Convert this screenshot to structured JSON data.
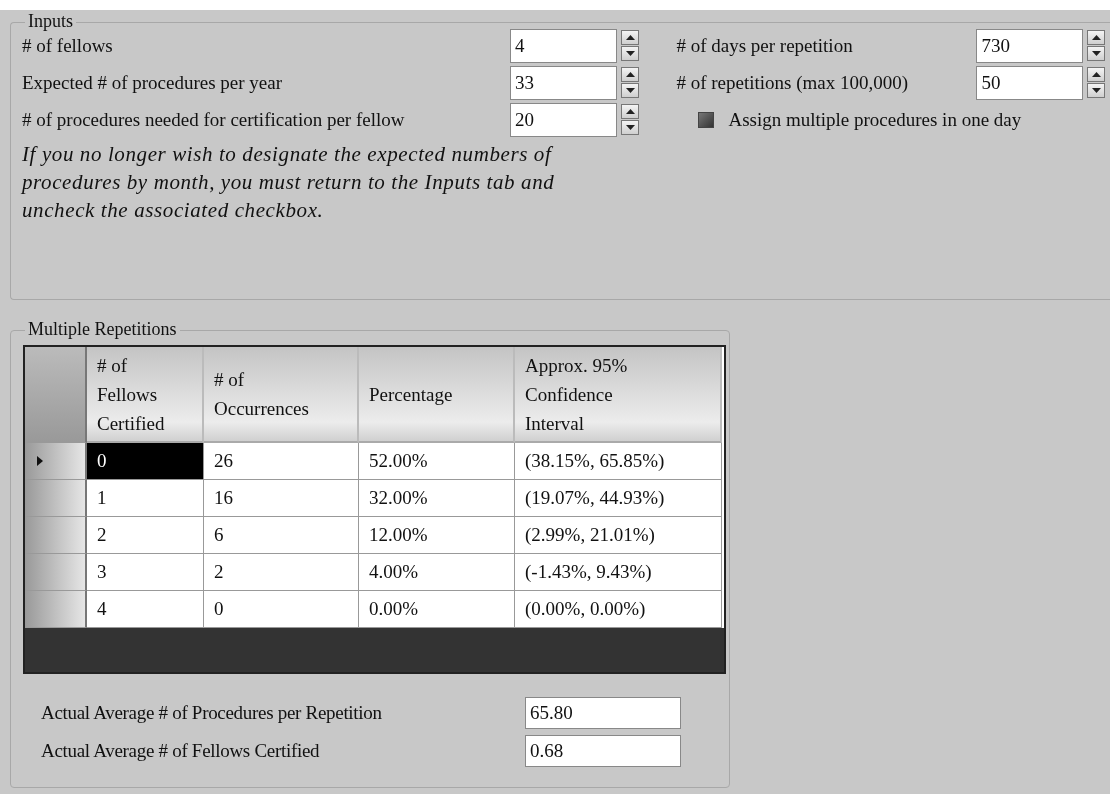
{
  "inputs": {
    "title": "Inputs",
    "left_fields": [
      {
        "label": "# of fellows",
        "value": "4"
      },
      {
        "label": "Expected # of procedures per year",
        "value": "33"
      },
      {
        "label": "# of procedures needed for certification per fellow",
        "value": "20"
      }
    ],
    "right_fields": [
      {
        "label": "# of days per repetition",
        "value": "730"
      },
      {
        "label": "# of repetitions (max 100,000)",
        "value": "50"
      }
    ],
    "checkbox": {
      "label": "Assign multiple procedures in one day",
      "checked": true
    },
    "note": "If you no longer wish to designate the expected numbers of procedures by month, you must return to the Inputs tab and uncheck the associated checkbox."
  },
  "repetitions": {
    "title": "Multiple Repetitions",
    "table": {
      "columns": [
        "# of\nFellows\nCertified",
        "# of\nOccurrences",
        "Percentage",
        "Approx. 95%\nConfidence\nInterval"
      ],
      "rows": [
        {
          "cells": [
            "0",
            "26",
            "52.00%",
            "(38.15%, 65.85%)"
          ],
          "selected": true
        },
        {
          "cells": [
            "1",
            "16",
            "32.00%",
            "(19.07%, 44.93%)"
          ],
          "selected": false
        },
        {
          "cells": [
            "2",
            "6",
            "12.00%",
            "(2.99%, 21.01%)"
          ],
          "selected": false
        },
        {
          "cells": [
            "3",
            "2",
            "4.00%",
            "(-1.43%, 9.43%)"
          ],
          "selected": false
        },
        {
          "cells": [
            "4",
            "0",
            "0.00%",
            "(0.00%, 0.00%)"
          ],
          "selected": false
        }
      ]
    },
    "averages": [
      {
        "label": "Actual Average # of Procedures per Repetition",
        "value": "65.80"
      },
      {
        "label": "Actual Average # of Fellows Certified",
        "value": "0.68"
      }
    ]
  }
}
